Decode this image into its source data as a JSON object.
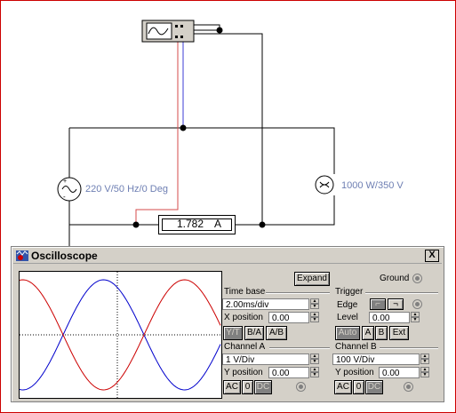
{
  "circuit": {
    "source_label": "220 V/50 Hz/0 Deg",
    "lamp_label": "1000 W/350 V",
    "ammeter_value": "1.782",
    "ammeter_unit": "A"
  },
  "scope": {
    "title": "Oscilloscope",
    "close_label": "X",
    "expand_label": "Expand",
    "ground_label": "Ground",
    "timebase": {
      "title": "Time base",
      "value": "2.00ms/div",
      "xpos_label": "X position",
      "xpos_value": "0.00",
      "yt_label": "Y/T",
      "ba_label": "B/A",
      "ab_label": "A/B"
    },
    "trigger": {
      "title": "Trigger",
      "edge_label": "Edge",
      "level_label": "Level",
      "level_value": "0.00",
      "auto_label": "Auto",
      "a_label": "A",
      "b_label": "B",
      "ext_label": "Ext"
    },
    "channel_a": {
      "title": "Channel A",
      "value": "1  V/Div",
      "ypos_label": "Y position",
      "ypos_value": "0.00",
      "ac_label": "AC",
      "zero_label": "0",
      "dc_label": "DC"
    },
    "channel_b": {
      "title": "Channel B",
      "value": "100  V/Div",
      "ypos_label": "Y position",
      "ypos_value": "0.00",
      "ac_label": "AC",
      "zero_label": "0",
      "dc_label": "DC"
    }
  },
  "colors": {
    "trace_a": "#0000cc",
    "trace_b": "#cc0000",
    "label_text": "#6e7fb3",
    "window_bg": "#d4d0c8"
  }
}
